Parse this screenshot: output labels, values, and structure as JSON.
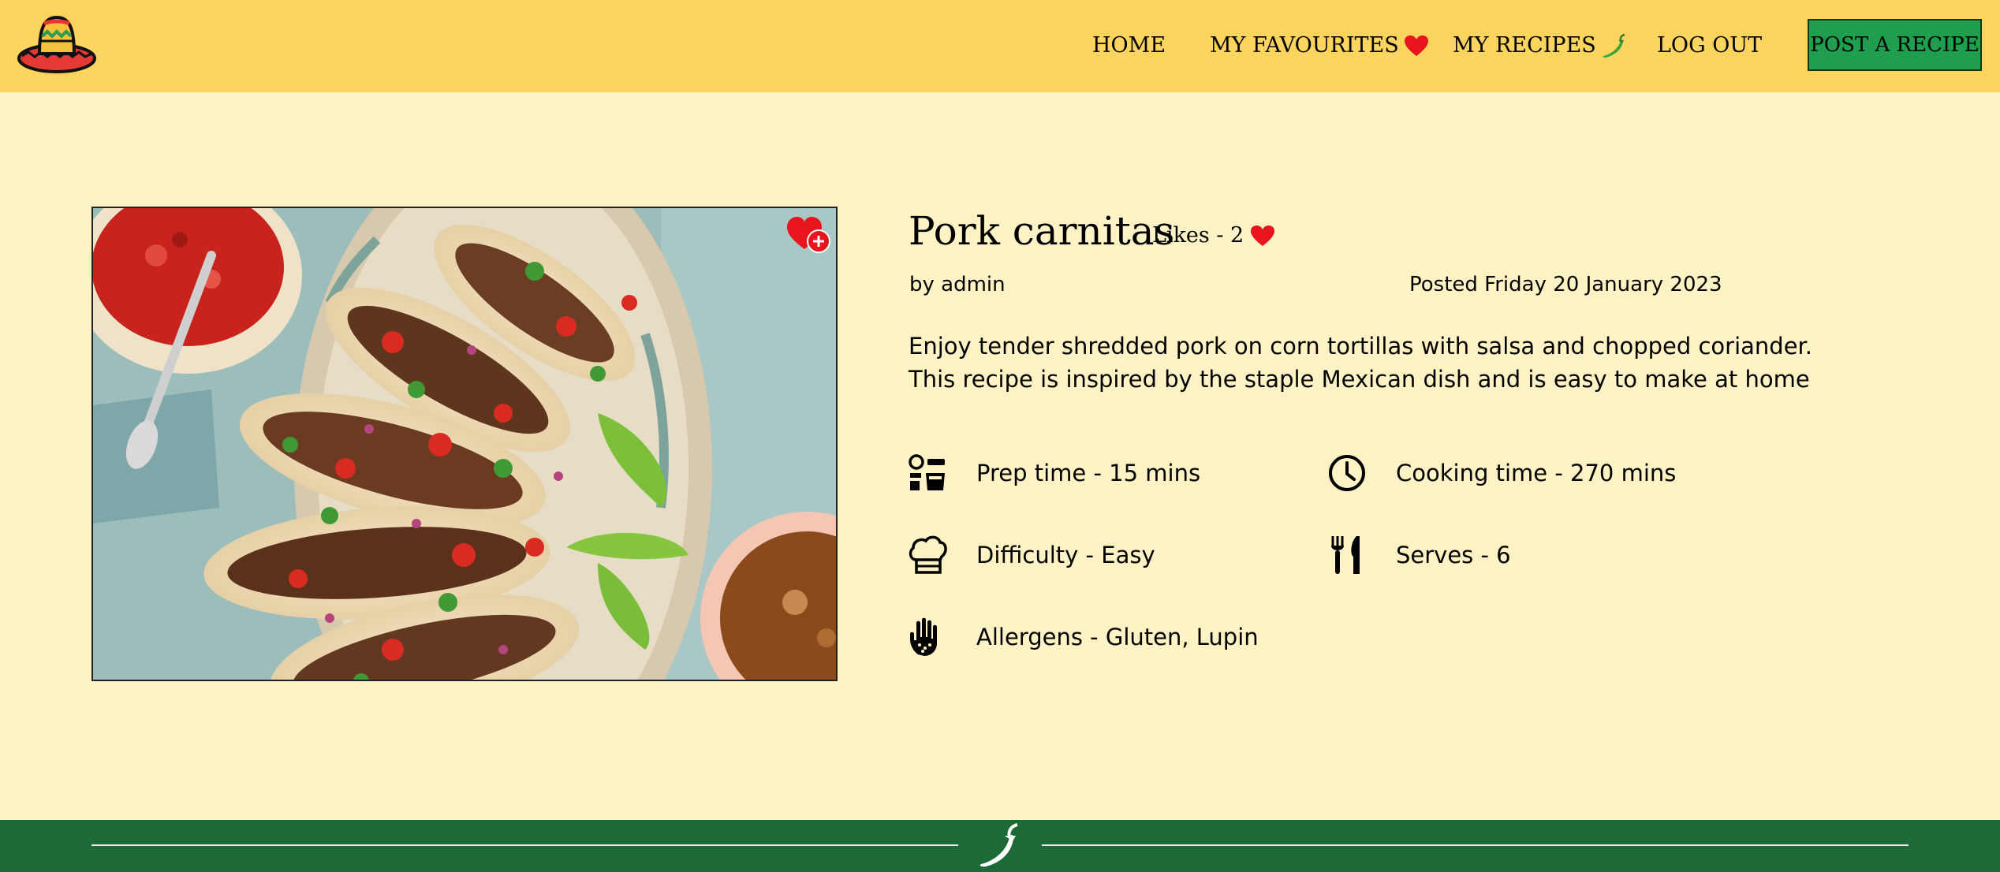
{
  "header": {
    "nav": {
      "home": "HOME",
      "favourites": "MY FAVOURITES",
      "recipes": "MY RECIPES",
      "logout": "LOG OUT"
    },
    "post_button": "POST A RECIPE",
    "logo_icon": "sombrero-icon"
  },
  "recipe": {
    "title": "Pork carnitas",
    "likes": "Likes - 2",
    "author": "by admin",
    "posted": "Posted Friday 20 January 2023",
    "description": "Enjoy tender shredded pork on corn tortillas with salsa and chopped coriander. This recipe is inspired by the staple Mexican dish and is easy to make at home",
    "info": {
      "prep": "Prep time - 15 mins",
      "cooking": "Cooking time - 270 mins",
      "difficulty": "Difficulty - Easy",
      "serves": "Serves - 6",
      "allergens": "Allergens - Gluten, Lupin"
    }
  },
  "colors": {
    "header_bg": "#FCD45E",
    "page_bg": "#FFF2C4",
    "post_button_bg": "#1F9E4E",
    "footer_bg": "#1D6A36",
    "heart": "#E8141E"
  }
}
